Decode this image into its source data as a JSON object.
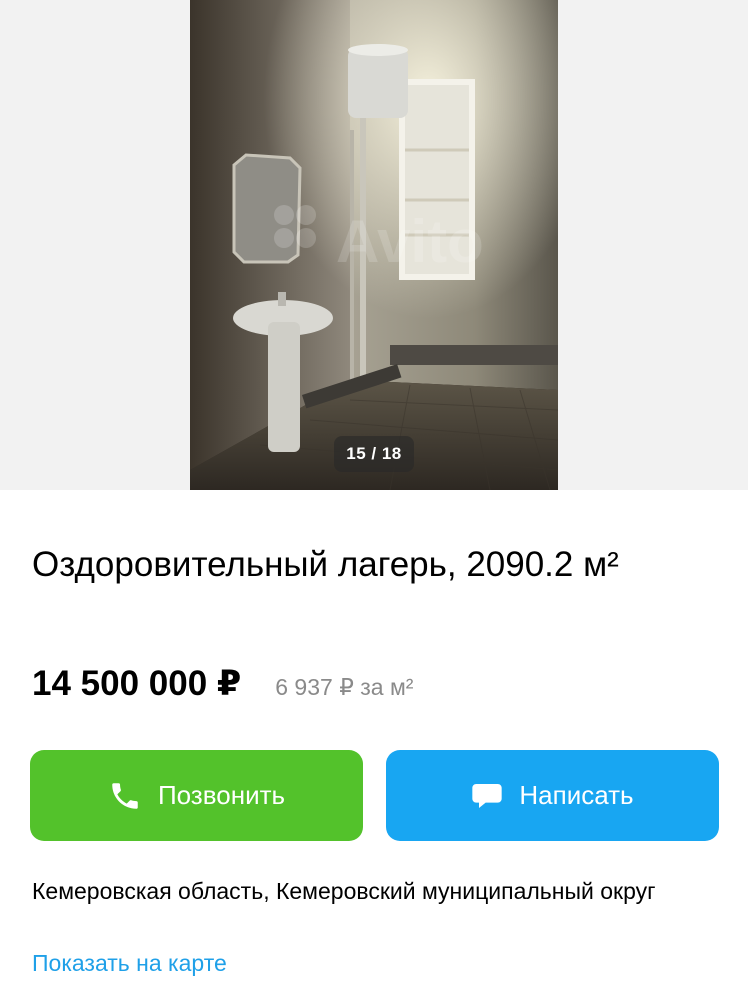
{
  "gallery": {
    "counter": "15 / 18",
    "watermark": "Avito"
  },
  "listing": {
    "title": "Оздоровительный лагерь, 2090.2 м²",
    "price": "14 500 000 ₽",
    "price_per_m2": "6 937 ₽ за м²"
  },
  "actions": {
    "call_label": "Позвонить",
    "write_label": "Написать"
  },
  "location": {
    "address": "Кемеровская область, Кемеровский муниципальный округ",
    "map_link": "Показать на карте"
  },
  "colors": {
    "call_button": "#53c22b",
    "write_button": "#18a6f2",
    "link": "#1fa0e8",
    "secondary_text": "#8a8a8a"
  },
  "icons": [
    "phone-icon",
    "chat-bubble-icon"
  ]
}
